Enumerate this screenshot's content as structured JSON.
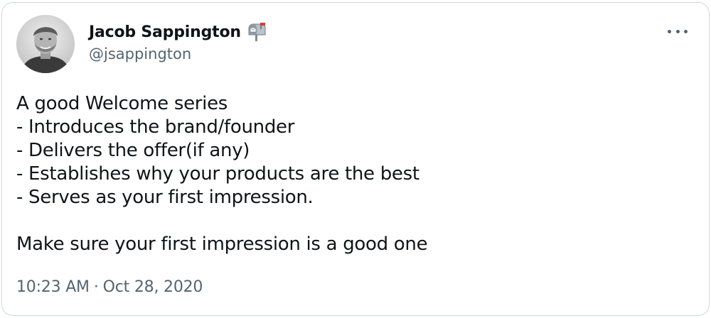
{
  "author": {
    "display_name": "Jacob Sappington",
    "handle": "@jsappington",
    "badge_icon": "mailbox-with-flag-icon"
  },
  "more_menu": {
    "icon": "more-horizontal-icon"
  },
  "tweet": {
    "lines": [
      "A good Welcome series",
      "- Introduces the brand/founder",
      "- Delivers the offer(if any)",
      "- Establishes why your products are the best",
      "- Serves as your first impression.",
      "",
      "Make sure your first impression is a good one"
    ]
  },
  "timestamp": {
    "time": "10:23 AM",
    "separator": "·",
    "date": "Oct 28, 2020"
  },
  "colors": {
    "text_primary": "#0f1419",
    "text_secondary": "#536471",
    "border": "#cfd9de",
    "flag_red": "#d93b3b"
  }
}
